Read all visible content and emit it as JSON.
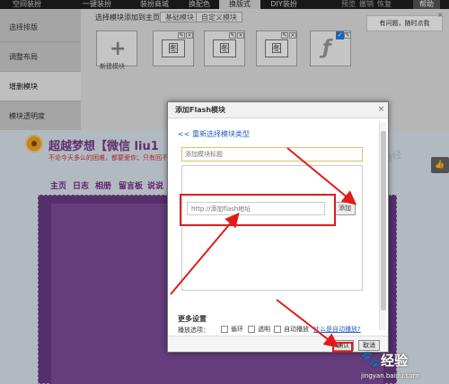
{
  "topnav": {
    "items": [
      "空间装扮",
      "一键装扮",
      "装扮商城",
      "换配色",
      "换版式",
      "DIY装扮"
    ],
    "util": [
      "预览",
      "撤销",
      "恢复"
    ],
    "help": "帮助"
  },
  "sidebar": {
    "items": [
      "选择排版",
      "调整布局",
      "增删模块",
      "模块透明度"
    ]
  },
  "modstrip": {
    "label": "选择模块添加到主页：",
    "tabs": [
      "基础模块",
      "自定义模块"
    ],
    "new_module_label": "新建模块",
    "module_glyph": "图"
  },
  "tooltip": {
    "text": "有问题，随时点我",
    "close": "×"
  },
  "blog": {
    "title": "超越梦想【微信 liu1",
    "subtitle": "不论今天多么的困难，都要爱你；只有回不",
    "nav": [
      "主页",
      "日志",
      "相册",
      "留言板",
      "说说"
    ],
    "like": "👍",
    "deco": "不诗经"
  },
  "dialog": {
    "title": "添加Flash模块",
    "close": "×",
    "back_link": "<< 重新选择模块类型",
    "title_placeholder": "添加模块标题",
    "url_placeholder": "http://添加flash地址",
    "add_button": "添加",
    "more_settings": "更多设置",
    "play_options_label": "播放选项：",
    "options": [
      "循环",
      "透明",
      "自动播放"
    ],
    "what_link": "什么是自动播放?",
    "ok_button": "确认",
    "cancel_button": "取消"
  },
  "annotation_color": "#e21b1b",
  "accent_color": "#6b3b86",
  "watermark": {
    "brand": "Bai",
    "main": "经验",
    "url": "jingyan.baidu.com"
  }
}
